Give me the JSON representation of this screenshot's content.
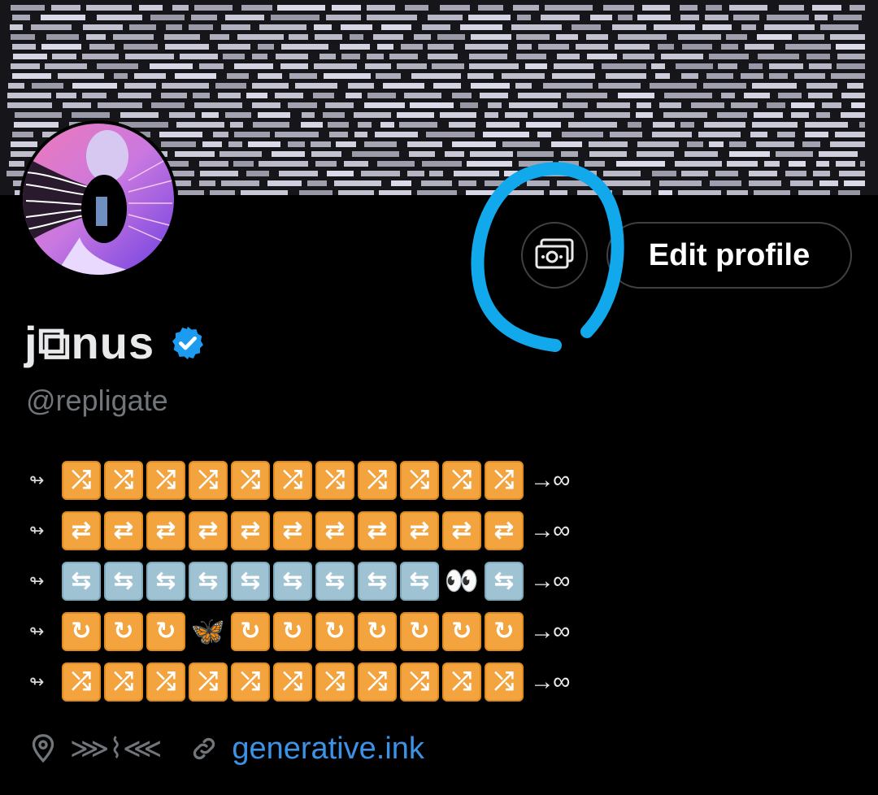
{
  "banner": {
    "image_name": "text-pattern-banner"
  },
  "avatar": {
    "image_name": "profile-avatar"
  },
  "actions": {
    "money_icon": "money-icon",
    "edit_label": "Edit profile"
  },
  "profile": {
    "display_name": "j⧉nus",
    "verified_icon": "verified-badge-icon",
    "verified_color": "#1d9bf0",
    "handle": "@repligate"
  },
  "bio": {
    "row_prefix": "↬",
    "row_suffix": "→∞",
    "rows": [
      [
        "🔀",
        "🔀",
        "🔀",
        "🔀",
        "🔀",
        "🔀",
        "🔀",
        "🔀",
        "🔀",
        "🔀",
        "🔀"
      ],
      [
        "🔁",
        "🔁",
        "🔁",
        "🔁",
        "🔁",
        "🔁",
        "🔁",
        "🔁",
        "🔁",
        "🔁",
        "🔁"
      ],
      [
        "🔄",
        "🔄",
        "🔄",
        "🔄",
        "🔄",
        "🔄",
        "🔄",
        "🔄",
        "🔄",
        "👀",
        "🔄"
      ],
      [
        "🔂",
        "🔂",
        "🔂",
        "🦋",
        "🔂",
        "🔂",
        "🔂",
        "🔂",
        "🔂",
        "🔂",
        "🔂"
      ],
      [
        "🔀",
        "🔀",
        "🔀",
        "🔀",
        "🔀",
        "🔀",
        "🔀",
        "🔀",
        "🔀",
        "🔀",
        "🔀"
      ]
    ]
  },
  "meta": {
    "location_icon": "location-pin-icon",
    "location": "⋙⌇⋘",
    "link_icon": "link-icon",
    "website": "generative.ink"
  },
  "colors": {
    "background": "#000000",
    "text": "#e7e9ea",
    "muted": "#71767b",
    "link": "#3b93e8",
    "annotation": "#12a9ec",
    "tile_orange": "#f3a43f",
    "tile_blue": "#9fc3d3"
  }
}
